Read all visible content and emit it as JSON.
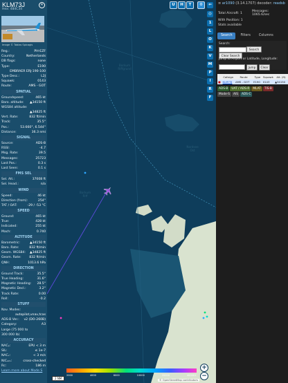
{
  "aircraft": {
    "callsign": "KLM73J",
    "hex_label": "Hex:",
    "hex": "484C34",
    "photo_credit": "Image © Tobias Spicagis",
    "rows_top": [
      {
        "k": "Reg.:",
        "v": "PH-EZF"
      },
      {
        "k": "Country:",
        "v": "Netherlands"
      },
      {
        "k": "DB flags:",
        "v": "none"
      },
      {
        "k": "Type:",
        "v": "E190"
      },
      {
        "k": "",
        "v": "EMBRAER ERJ-190-100"
      },
      {
        "k": "Type Desc.:",
        "v": "L2J"
      },
      {
        "k": "Squawk:",
        "v": "0143"
      },
      {
        "k": "Route:",
        "v": "AMS - GOT"
      }
    ],
    "sections": [
      {
        "title": "SPATIAL",
        "rows": [
          {
            "k": "Groundspeed:",
            "v": "465 kt"
          },
          {
            "k": "Baro. altitude:",
            "v": "▲34150 ft"
          },
          {
            "k": "WGS84 altitude:",
            "v": ""
          },
          {
            "k": "",
            "v": "▲34825 ft"
          },
          {
            "k": "Vert. Rate:",
            "v": "832 ft/min"
          },
          {
            "k": "Track:",
            "v": "35.5°"
          },
          {
            "k": "Pos.:",
            "v": "53.660°, 6.544°"
          },
          {
            "k": "Distance:",
            "v": "36.3 nmi"
          }
        ]
      },
      {
        "title": "SIGNAL",
        "rows": [
          {
            "k": "Source:",
            "v": "ADS-B"
          },
          {
            "k": "RSSI:",
            "v": "-4.7"
          },
          {
            "k": "Msg. Rate:",
            "v": "39.5"
          },
          {
            "k": "Messages:",
            "v": "25723"
          },
          {
            "k": "Last Pos.:",
            "v": "0.3 s"
          },
          {
            "k": "Last Seen:",
            "v": "0.1 s"
          }
        ]
      },
      {
        "title": "FMS SEL",
        "rows": [
          {
            "k": "Sel. Alt.:",
            "v": "37008 ft"
          },
          {
            "k": "Sel. Head.:",
            "v": "n/a"
          }
        ]
      },
      {
        "title": "WIND",
        "rows": [
          {
            "k": "Speed:",
            "v": "46 kt"
          },
          {
            "k": "Direction (from):",
            "v": "254°"
          },
          {
            "k": "TAT / OAT:",
            "v": "-29 / -53 °C"
          }
        ]
      },
      {
        "title": "SPEED",
        "rows": [
          {
            "k": "Ground:",
            "v": "465 kt"
          },
          {
            "k": "True:",
            "v": "428 kt"
          },
          {
            "k": "Indicated:",
            "v": "255 kt"
          },
          {
            "k": "Mach:",
            "v": "0.740"
          }
        ]
      },
      {
        "title": "ALTITUDE",
        "rows": [
          {
            "k": "Barometric:",
            "v": "▲34150 ft"
          },
          {
            "k": "Baro. Rate:",
            "v": "832 ft/min"
          },
          {
            "k": "Geom. WGS84:",
            "v": "▲34825 ft"
          },
          {
            "k": "Geom. Rate:",
            "v": "832 ft/min"
          },
          {
            "k": "QNH:",
            "v": "1013.6 hPa"
          }
        ]
      },
      {
        "title": "DIRECTION",
        "rows": [
          {
            "k": "Ground Track:",
            "v": "35.5°"
          },
          {
            "k": "True Heading:",
            "v": "31.6°"
          },
          {
            "k": "Magnetic Heading:",
            "v": "28.5°"
          },
          {
            "k": "Magnetic Decl.:",
            "v": "3.2°"
          },
          {
            "k": "Track Rate:",
            "v": "0.00"
          },
          {
            "k": "Roll:",
            "v": "-0.2"
          }
        ]
      },
      {
        "title": "STUFF",
        "rows": [
          {
            "k": "Nav. Modes:",
            "v": ""
          },
          {
            "k": "",
            "v": "autopilot,vnav,tcas"
          },
          {
            "k": "ADS-B Ver.:",
            "v": "v2 (DO-260B)"
          },
          {
            "k": "Category:",
            "v": "A3"
          },
          {
            "k": "Large (75 000 to",
            "v": ""
          },
          {
            "k": "300 000 lb)",
            "v": ""
          }
        ]
      },
      {
        "title": "ACCURACY",
        "rows": [
          {
            "k": "NACₚ:",
            "v": "EPU < 3 m"
          },
          {
            "k": "SIL:",
            "v": "≤ 1e-7"
          },
          {
            "k": "NACᵥ:",
            "v": "< 3 m/s"
          },
          {
            "k": "NICₐᵢᵣₒ:",
            "v": "cross-checked"
          },
          {
            "k": "Rᴄ:",
            "v": "186 m"
          }
        ]
      }
    ],
    "more_link": "Learn more about Mode S"
  },
  "map": {
    "top_buttons": [
      "U",
      "H",
      "T"
    ],
    "side_buttons": [
      "⇐",
      "1",
      "L",
      "O",
      "K",
      "M",
      "P",
      "I",
      "R",
      "F"
    ],
    "labels": {
      "borkum_riff": "Borkum\nRiffgrund",
      "borkum": "Borkum\nRiff",
      "nordsee": "Nordsee\nOst",
      "tobbins": "Tobbins"
    },
    "scale_label": "2 NM",
    "color_ticks": [
      "2000",
      "4000",
      "6000",
      "10000",
      "20000",
      "40000+"
    ],
    "attribution": "© OpenStreetMap contributors",
    "zoom_in": "+",
    "zoom_out": "−"
  },
  "sidebar": {
    "header_prefix": "≡",
    "header_link": "ar1090",
    "version": "(3.14.1707)",
    "decoder_label": "decoder:",
    "decoder_value": "readsb",
    "total_label": "Total Aircraft:",
    "total_value": "1",
    "messages_label": "Messages:",
    "messages_value": "1065.6/sec",
    "position_label": "With Position:",
    "position_value": "1",
    "stats_label": "Stats available",
    "tabs": [
      "Search",
      "Filters",
      "Columns"
    ],
    "search_label": "Search:",
    "search_button": "Search",
    "clear_search": "Clear Search",
    "jump_text": "Jump to Airport or Latitude, Longitude:",
    "jump_button": "Jump",
    "clear_button": "Clear",
    "columns": [
      "",
      "Callsign",
      "Route",
      "Type",
      "Squawk",
      "Alt. (ft)"
    ],
    "row": [
      "■",
      "KLM73J",
      "AMS - GOT",
      "E190",
      "0143",
      "▲34150"
    ],
    "tags": [
      {
        "text": "ADS-B",
        "color": "#2d5a2d"
      },
      {
        "text": "UAT / ADS-R",
        "color": "#4d6b2b"
      },
      {
        "text": "MLAT",
        "color": "#6b5a1d"
      },
      {
        "text": "TIS-B",
        "color": "#7b2a2a"
      },
      {
        "text": "Mode-S",
        "color": "#444444"
      },
      {
        "text": "AIS",
        "color": "#444444"
      },
      {
        "text": "ADS-C",
        "color": "#2b5a5a"
      }
    ]
  }
}
